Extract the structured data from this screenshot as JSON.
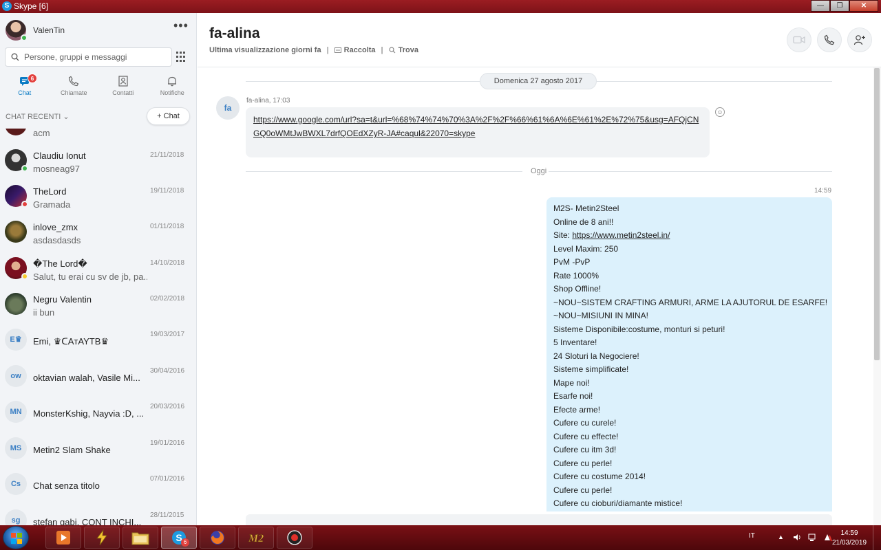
{
  "window": {
    "title": "Skype [6]"
  },
  "profile": {
    "name": "ValenTin"
  },
  "search": {
    "placeholder": "Persone, gruppi e messaggi"
  },
  "nav": [
    {
      "label": "Chat",
      "badge": "6"
    },
    {
      "label": "Chiamate"
    },
    {
      "label": "Contatti"
    },
    {
      "label": "Notifiche"
    }
  ],
  "recent": {
    "header": "CHAT RECENTI",
    "new_chat": "Chat"
  },
  "chats": [
    {
      "name": "",
      "preview": "acm",
      "date": ""
    },
    {
      "name": "Claudiu Ionut",
      "preview": "mosneag97",
      "date": "21/11/2018",
      "status": "online"
    },
    {
      "name": "TheLord",
      "preview": "Gramada",
      "date": "19/11/2018",
      "status": "busy"
    },
    {
      "name": "inlove_zmx",
      "preview": "asdasdasds",
      "date": "01/11/2018"
    },
    {
      "name": "�The Lord�",
      "preview": "Salut, tu erai cu sv de jb, pa...",
      "date": "14/10/2018",
      "status": "away"
    },
    {
      "name": "Negru Valentin",
      "preview": "ii bun",
      "date": "02/02/2018"
    },
    {
      "name": "Emi, ♛ᑕAᴛAYTB♛",
      "preview": "",
      "date": "19/03/2017",
      "initials": "E♛"
    },
    {
      "name": "oktavian walah, Vasile Mi...",
      "preview": "",
      "date": "30/04/2016",
      "initials": "ow"
    },
    {
      "name": "MonsterKshig, Nayvia :D, ...",
      "preview": "",
      "date": "20/03/2016",
      "initials": "MN"
    },
    {
      "name": "Metin2 Slam Shake",
      "preview": "",
      "date": "19/01/2016",
      "initials": "MS"
    },
    {
      "name": "Chat senza titolo",
      "preview": "",
      "date": "07/01/2016",
      "initials": "Cs"
    },
    {
      "name": "stefan gabi, CONT INCHI...",
      "preview": "",
      "date": "28/11/2015",
      "initials": "sg"
    }
  ],
  "conversation": {
    "title": "fa-alina",
    "last_seen": "Ultima visualizzazione giorni fa",
    "gallery": "Raccolta",
    "find": "Trova",
    "date_divider": "Domenica 27 agosto 2017",
    "avatar_initials": "fa",
    "incoming_meta": "fa-alina, 17:03",
    "incoming_link": "https://www.google.com/url?sa=t&url=%68%74%74%70%3A%2F%2F%66%61%6A%6E%61%2E%72%75&usg=AFQjCNGQ0oWMtJwBWXL7drfQOEdXZyR-JA#caqul&22070=skype",
    "today_divider": "Oggi",
    "outgoing_time": "14:59",
    "outgoing_lines": [
      "M2S- Metin2Steel",
      "Online de 8 ani!!",
      "Site: ",
      "Level Maxim: 250",
      "PvM -PvP",
      "Rate 1000%",
      "Shop Offline!",
      "~NOU~SISTEM CRAFTING ARMURI, ARME LA AJUTORUL DE ESARFE!",
      "~NOU~MISIUNI IN MINA!",
      "Sisteme Disponibile:costume, monturi si peturi!",
      "5 Inventare!",
      "24 Sloturi la Negociere!",
      "Sisteme simplificate!",
      "Mape noi!",
      "Esarfe noi!",
      "Efecte arme!",
      "Cufere cu curele!",
      "Cufere cu effecte!",
      "Cufere cu itm 3d!",
      "Cufere cu perle!",
      "Cufere cu costume 2014!",
      "Cufere cu perle!",
      "Cufere cu cioburi/diamante mistice!"
    ],
    "site_link": "https://www.metin2steel.in/"
  },
  "taskbar": {
    "skype_badge": "6",
    "language": "IT",
    "time": "14:59",
    "date": "21/03/2019"
  },
  "colors": {
    "accent": "#0a7bc4",
    "outgoing_bubble": "#dcf1fc",
    "incoming_bubble": "#f1f3f5",
    "taskbar": "#5e0a0f"
  }
}
